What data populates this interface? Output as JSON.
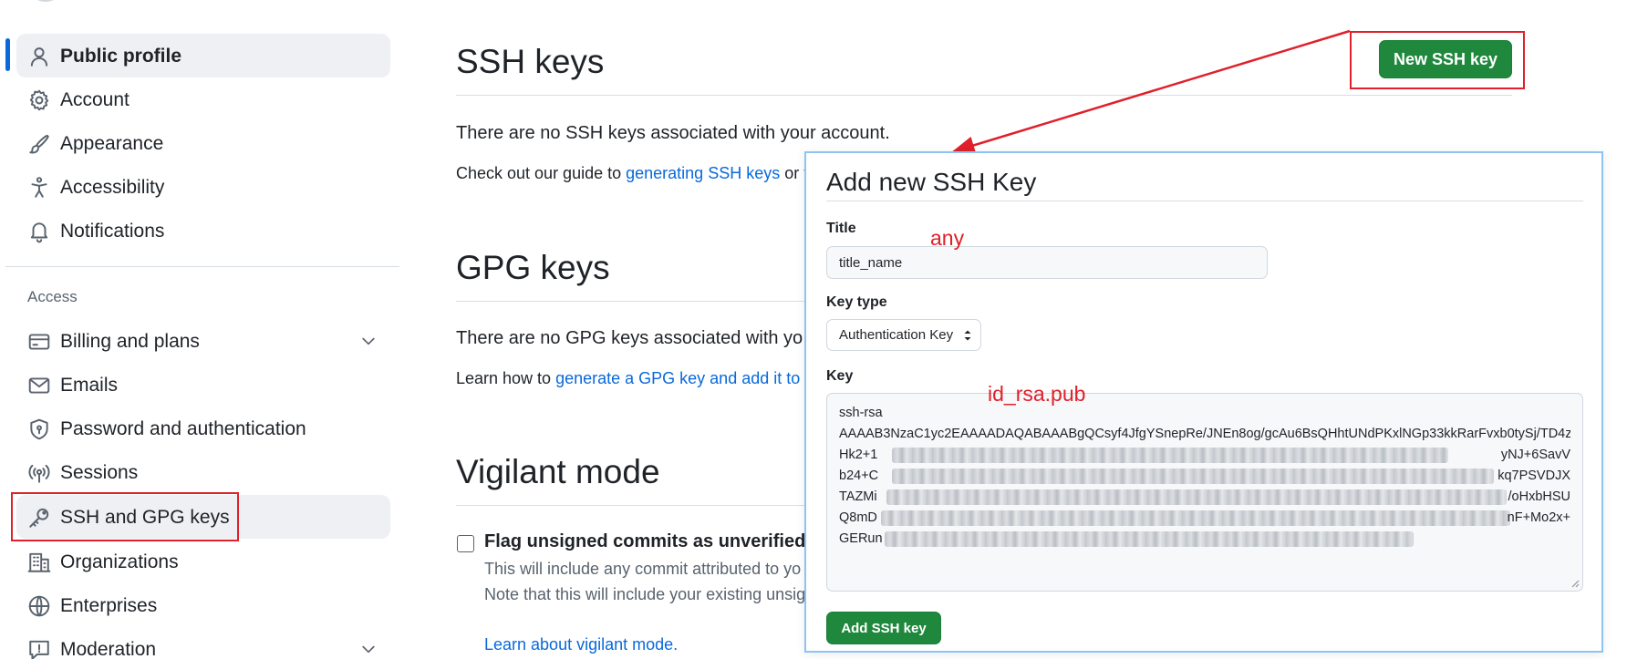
{
  "sidebar": {
    "items": [
      {
        "label": "Public profile",
        "icon": "person-icon"
      },
      {
        "label": "Account",
        "icon": "gear-icon"
      },
      {
        "label": "Appearance",
        "icon": "paintbrush-icon"
      },
      {
        "label": "Accessibility",
        "icon": "accessibility-icon"
      },
      {
        "label": "Notifications",
        "icon": "bell-icon"
      },
      {
        "label": "Billing and plans",
        "icon": "credit-card-icon"
      },
      {
        "label": "Emails",
        "icon": "mail-icon"
      },
      {
        "label": "Password and authentication",
        "icon": "shield-lock-icon"
      },
      {
        "label": "Sessions",
        "icon": "broadcast-icon"
      },
      {
        "label": "SSH and GPG keys",
        "icon": "key-icon"
      },
      {
        "label": "Organizations",
        "icon": "organization-icon"
      },
      {
        "label": "Enterprises",
        "icon": "globe-icon"
      },
      {
        "label": "Moderation",
        "icon": "report-icon"
      }
    ],
    "access_heading": "Access"
  },
  "ssh": {
    "heading": "SSH keys",
    "new_button": "New SSH key",
    "empty_text": "There are no SSH keys associated with your account.",
    "guide_prefix": "Check out our guide to ",
    "guide_link": "generating SSH keys",
    "guide_suffix": " or t"
  },
  "gpg": {
    "heading": "GPG keys",
    "empty_text": "There are no GPG keys associated with yo",
    "learn_prefix": "Learn how to ",
    "learn_link": "generate a GPG key and add it to y"
  },
  "vigilant": {
    "heading": "Vigilant mode",
    "checkbox_label": "Flag unsigned commits as unverified",
    "desc_line1": "This will include any commit attributed to yo",
    "desc_line2": "Note that this will include your existing unsig",
    "learn_link": "Learn about vigilant mode."
  },
  "modal": {
    "title": "Add new SSH Key",
    "title_label": "Title",
    "title_value": "title_name",
    "key_type_label": "Key type",
    "key_type_value": "Authentication Key",
    "key_label": "Key",
    "key_lines": [
      "ssh-rsa",
      "AAAAB3NzaC1yc2EAAAADAQABAAABgQCsyf4JfgYSnepRe/JNEn8og/gcAu6BsQHhtUNdPKxlNGp33kkRarFvxb0tySj/TD4z",
      "Hk2+1",
      "b24+C",
      "TAZMi",
      "Q8mD",
      "GERun"
    ],
    "key_line_ends": [
      "",
      "",
      "yNJ+6SavV",
      "kq7PSVDJX",
      "/oHxbHSU",
      "nF+Mo2x+",
      ""
    ],
    "submit": "Add SSH key"
  },
  "annotations": {
    "title_note": "any",
    "key_note": "id_rsa.pub"
  },
  "colors": {
    "accent": "#0969da",
    "primary_button": "#1f883d",
    "annotation": "#e0202a",
    "modal_border": "#8fc3f2"
  }
}
